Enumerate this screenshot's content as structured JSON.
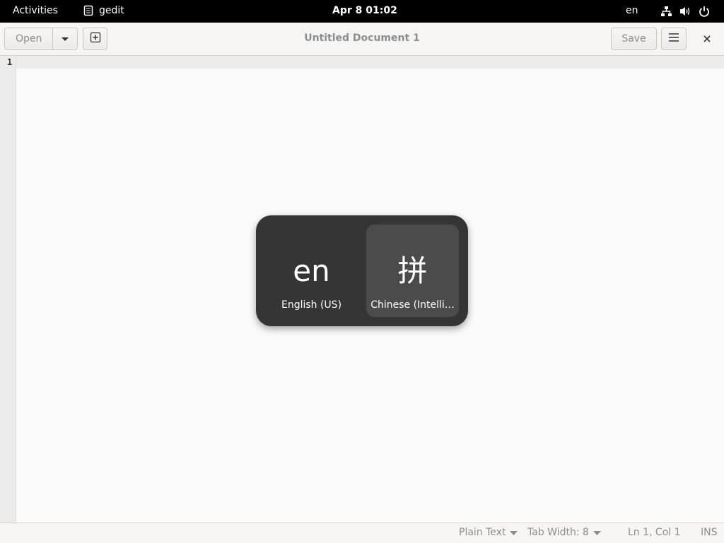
{
  "topbar": {
    "activities": "Activities",
    "app_name": "gedit",
    "clock": "Apr 8  01:02",
    "input_indicator": "en"
  },
  "headerbar": {
    "open_label": "Open",
    "title": "Untitled Document 1",
    "save_label": "Save"
  },
  "editor": {
    "line_numbers": [
      "1"
    ],
    "content": ""
  },
  "statusbar": {
    "language": "Plain Text",
    "tab_width": "Tab Width: 8",
    "position": "Ln 1, Col 1",
    "mode": "INS"
  },
  "input_switcher": {
    "sources": [
      {
        "symbol": "en",
        "name": "English (US)",
        "selected": false
      },
      {
        "symbol": "拼",
        "name": "Chinese (Intelli…",
        "selected": true
      }
    ]
  },
  "colors": {
    "topbar_bg": "#000000",
    "switcher_bg": "#353535",
    "switcher_selected": "#4b4b4b",
    "editor_bg": "#fafafa"
  }
}
